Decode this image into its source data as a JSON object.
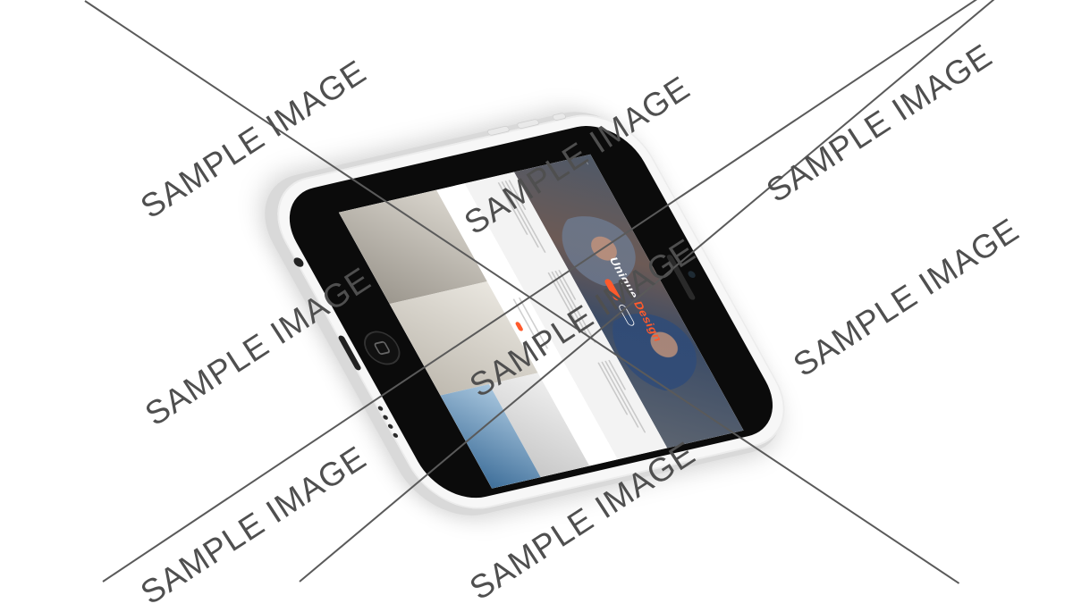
{
  "mockup": {
    "device": "white smartphone",
    "body_color": "#f7f7f7",
    "screen": {
      "hero": {
        "title_primary": "Unique",
        "title_accent": "Design",
        "accent_color": "#ff5a2c"
      },
      "showcase": {
        "accent_color": "#ff5a2c"
      }
    }
  },
  "watermark": {
    "text": "SAMPLE IMAGE",
    "color": "#4f4f4f"
  }
}
